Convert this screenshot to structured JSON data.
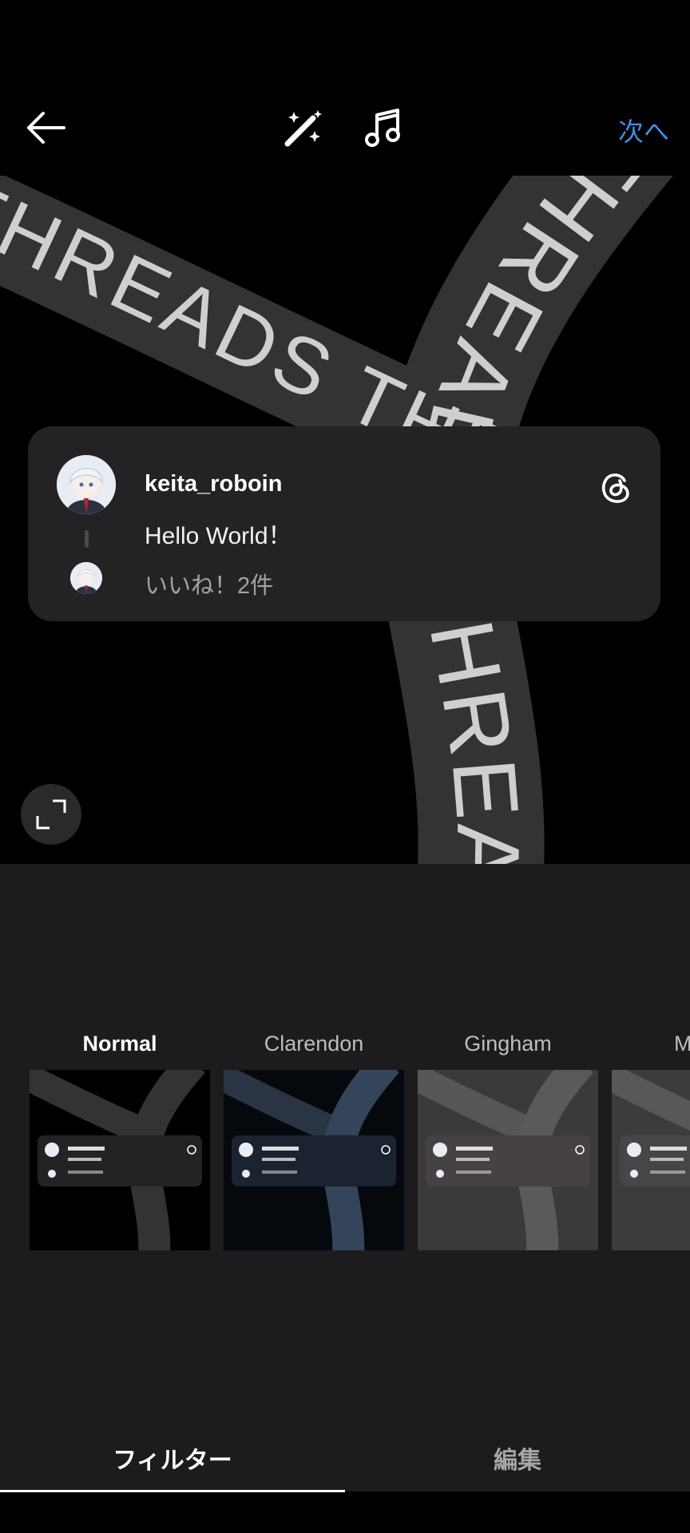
{
  "header": {
    "back_icon": "arrow-left-icon",
    "magic_icon": "magic-wand-sparkle-icon",
    "music_icon": "music-note-icon",
    "next_label": "次へ",
    "accent_color": "#3b8fe8"
  },
  "preview": {
    "band_text": "THREADS THREADS THREADS THREADS THREADS THREADS",
    "card": {
      "username": "keita_roboin",
      "post_text": "Hello World！",
      "likes": "いいね！2件",
      "logo_icon": "threads-logo-icon"
    },
    "expand_icon": "expand-corners-icon"
  },
  "filters": [
    {
      "name": "Normal",
      "active": true
    },
    {
      "name": "Clarendon",
      "active": false
    },
    {
      "name": "Gingham",
      "active": false
    },
    {
      "name": "M",
      "active": false
    }
  ],
  "tabs": {
    "filter_label": "フィルター",
    "edit_label": "編集"
  }
}
